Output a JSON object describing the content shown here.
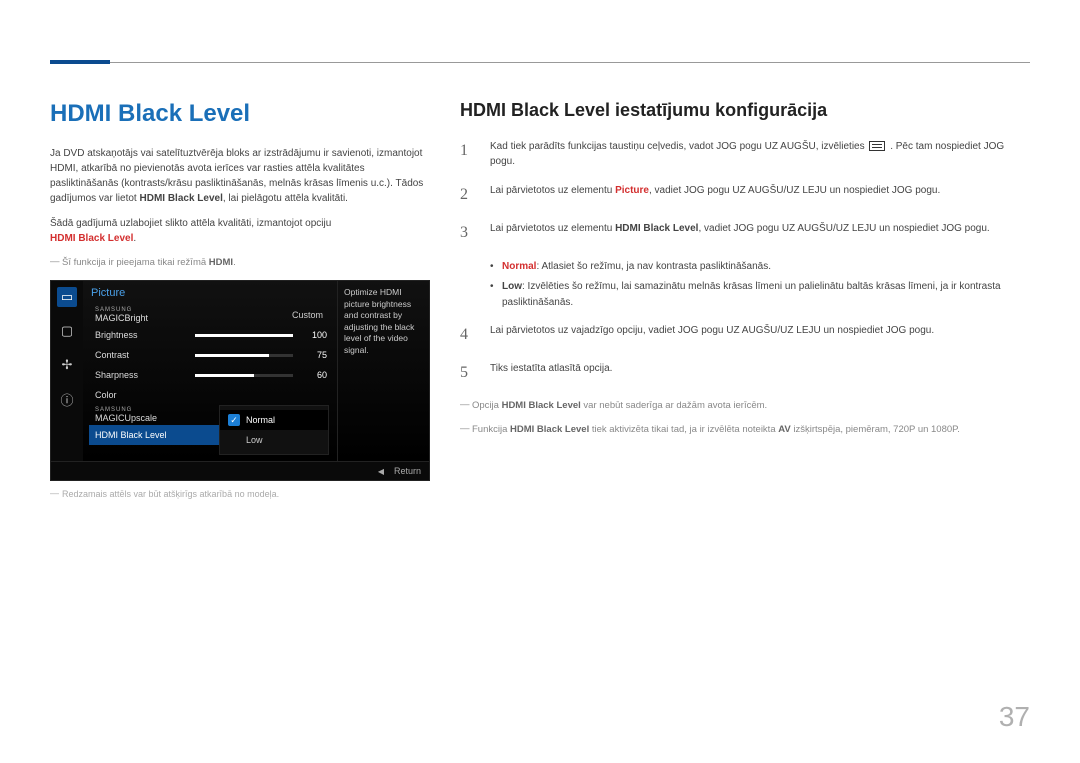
{
  "page_number": "37",
  "left": {
    "title": "HDMI Black Level",
    "intro_plain_1": "Ja DVD atskaņotājs vai satelītuztvērēja bloks ar izstrādājumu ir savienoti, izmantojot HDMI, atkarībā no pievienotās avota ierīces var rasties attēla kvalitātes pasliktināšanās (kontrasts/krāsu pasliktināšanās, melnās krāsas līmenis u.c.). Tādos gadījumos var lietot ",
    "intro_bold_1": "HDMI Black Level",
    "intro_plain_2": ", lai pielāgotu attēla kvalitāti.",
    "para2_plain": "Šādā gadījumā uzlabojiet slikto attēla kvalitāti, izmantojot opciju ",
    "para2_red": "HDMI Black Level",
    "note1_plain": "Šī funkcija ir pieejama tikai režīmā ",
    "note1_bold": "HDMI",
    "img_note": "Redzamais attēls var būt atšķirīgs atkarībā no modeļa."
  },
  "osd": {
    "title": "Picture",
    "magic_prefix": "SAMSUNG",
    "rows": {
      "bright_label": "Bright",
      "bright_val": "Custom",
      "brightness_label": "Brightness",
      "brightness_val": "100",
      "contrast_label": "Contrast",
      "contrast_val": "75",
      "sharpness_label": "Sharpness",
      "sharpness_val": "60",
      "color_label": "Color",
      "upscale_label": "Upscale",
      "hbl_label": "HDMI Black Level"
    },
    "submenu": {
      "normal": "Normal",
      "low": "Low"
    },
    "help": "Optimize HDMI picture brightness and contrast by adjusting the black level of the video signal.",
    "footer_return": "Return"
  },
  "right": {
    "subtitle": "HDMI Black Level iestatījumu konfigurācija",
    "steps": [
      {
        "num": "1",
        "pre": "Kad tiek parādīts funkcijas taustiņu ceļvedis, vadot JOG pogu UZ AUGŠU, izvēlieties ",
        "icon": true,
        "post": ". Pēc tam nospiediet JOG pogu."
      },
      {
        "num": "2",
        "pre": "Lai pārvietotos uz elementu ",
        "red": "Picture",
        "post": ", vadiet JOG pogu UZ AUGŠU/UZ LEJU un nospiediet JOG pogu."
      },
      {
        "num": "3",
        "pre": "Lai pārvietotos uz elementu ",
        "bold": "HDMI Black Level",
        "post": ", vadiet JOG pogu UZ AUGŠU/UZ LEJU un nospiediet JOG pogu."
      }
    ],
    "bullets": [
      {
        "red": "Normal",
        "text": ": Atlasiet šo režīmu, ja nav kontrasta pasliktināšanās."
      },
      {
        "bold": "Low",
        "text": ": Izvēlēties šo režīmu, lai samazinātu melnās krāsas līmeni un palielinātu baltās krāsas līmeni, ja ir kontrasta pasliktināšanās."
      }
    ],
    "step4": {
      "num": "4",
      "text": "Lai pārvietotos uz vajadzīgo opciju, vadiet JOG pogu UZ AUGŠU/UZ LEJU un nospiediet JOG pogu."
    },
    "step5": {
      "num": "5",
      "text": "Tiks iestatīta atlasītā opcija."
    },
    "note_a_pre": "Opcija ",
    "note_a_bold": "HDMI Black Level",
    "note_a_post": " var nebūt saderīga ar dažām avota ierīcēm.",
    "note_b_pre": "Funkcija ",
    "note_b_bold": "HDMI Black Level",
    "note_b_mid": " tiek aktivizēta tikai tad, ja ir izvēlēta noteikta ",
    "note_b_bold2": "AV",
    "note_b_post": " izšķirtspēja, piemēram, 720P un 1080P."
  }
}
